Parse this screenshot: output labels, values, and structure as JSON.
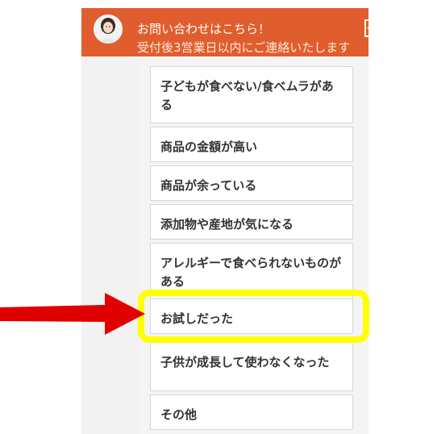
{
  "header": {
    "line1": "お問い合わせはこちら！",
    "line2": "受付後3営業日以内にご連絡いたします",
    "background": "#e05e2d"
  },
  "icons": {
    "avatar": "person-avatar",
    "home": "home-icon",
    "close": "minimize-icon"
  },
  "options": [
    "子どもが食べない/食べムラがある",
    "商品の金額が高い",
    "商品が余っている",
    "添加物や産地が気になる",
    "アレルギーで食べられないものがある",
    "お試しだった",
    "子供が成長して使わなくなった",
    "その他"
  ],
  "annotation": {
    "highlight_color": "#ffff00",
    "arrow_color": "#e00000",
    "highlighted_option": "お試しだった"
  }
}
